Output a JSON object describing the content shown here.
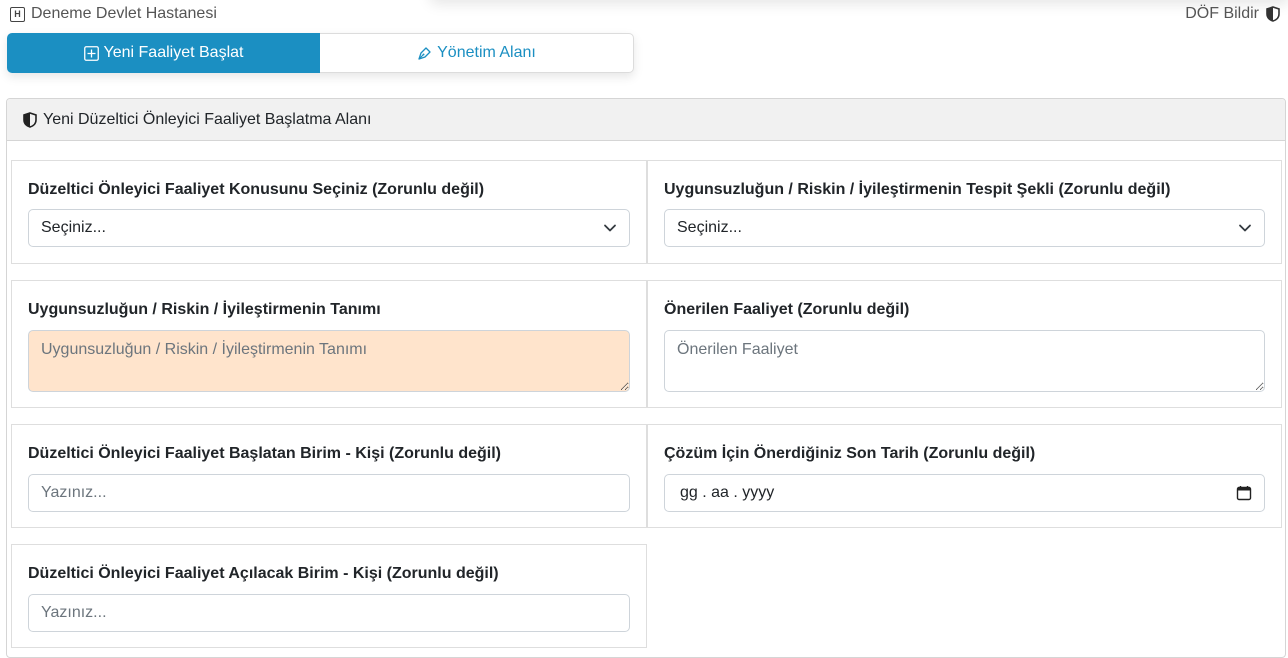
{
  "topbar": {
    "brand": "Deneme Devlet Hastanesi",
    "brand_icon": "h-square-icon",
    "report_link": "DÖF Bildir",
    "report_icon": "shield-half-icon"
  },
  "tabs": [
    {
      "label": "Yeni Faaliyet Başlat",
      "icon": "plus-square-icon",
      "active": true
    },
    {
      "label": "Yönetim Alanı",
      "icon": "pen-nib-icon",
      "active": false
    }
  ],
  "panel": {
    "title": "Yeni Düzeltici Önleyici Faaliyet Başlatma Alanı",
    "icon": "shield-half-icon"
  },
  "form": {
    "topic": {
      "label": "Düzeltici Önleyici Faaliyet Konusunu Seçiniz (Zorunlu değil)",
      "value": "Seçiniz..."
    },
    "detection": {
      "label": "Uygunsuzluğun / Riskin / İyileştirmenin Tespit Şekli (Zorunlu değil)",
      "value": "Seçiniz..."
    },
    "description": {
      "label": "Uygunsuzluğun / Riskin / İyileştirmenin Tanımı",
      "placeholder": "Uygunsuzluğun / Riskin / İyileştirmenin Tanımı"
    },
    "suggested": {
      "label": "Önerilen Faaliyet (Zorunlu değil)",
      "placeholder": "Önerilen Faaliyet"
    },
    "initiator": {
      "label": "Düzeltici Önleyici Faaliyet Başlatan Birim - Kişi (Zorunlu değil)",
      "placeholder": "Yazınız..."
    },
    "deadline": {
      "label": "Çözüm İçin Önerdiğiniz Son Tarih (Zorunlu değil)",
      "value": "gg . aa . yyyy"
    },
    "target": {
      "label": "Düzeltici Önleyici Faaliyet Açılacak Birim - Kişi (Zorunlu değil)",
      "placeholder": "Yazınız..."
    }
  },
  "colors": {
    "primary": "#1b8fc2",
    "required_field_bg": "#ffe4cc",
    "panel_header_bg": "#f1f1f1"
  }
}
